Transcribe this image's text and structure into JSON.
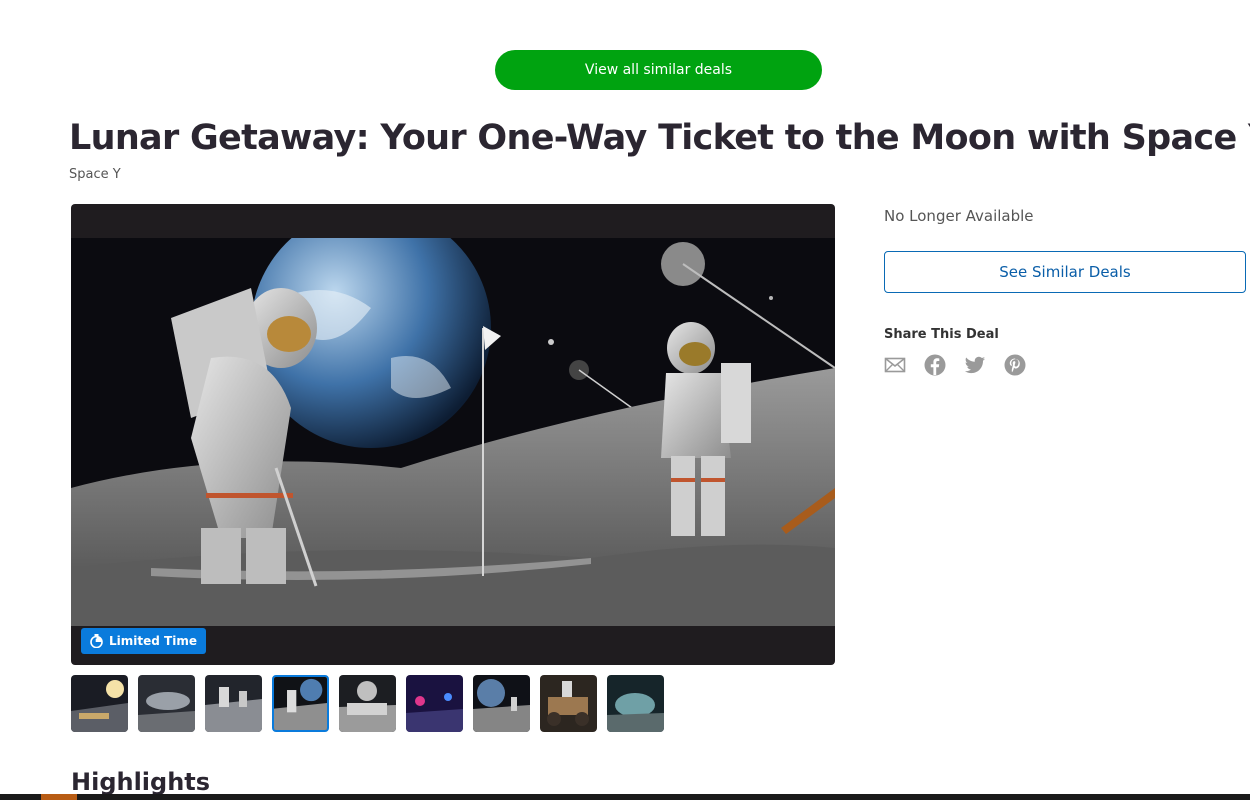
{
  "top_button": {
    "label": "View all similar deals"
  },
  "deal": {
    "title": "Lunar Getaway: Your One-Way Ticket to the Moon with Space Y",
    "merchant": "Space Y",
    "badge": "Limited Time"
  },
  "sidebar": {
    "status": "No Longer Available",
    "similar_button": "See Similar Deals",
    "share_label": "Share This Deal",
    "share_icons": [
      "email-icon",
      "facebook-icon",
      "twitter-icon",
      "pinterest-icon"
    ]
  },
  "gallery": {
    "thumbnail_count": 9,
    "active_index": 3
  },
  "section": {
    "highlights_heading": "Highlights"
  },
  "colors": {
    "green_button": "#00a310",
    "accent_blue": "#0a7bdc",
    "link_blue": "#0a5ea8",
    "title_text": "#2b2631"
  }
}
